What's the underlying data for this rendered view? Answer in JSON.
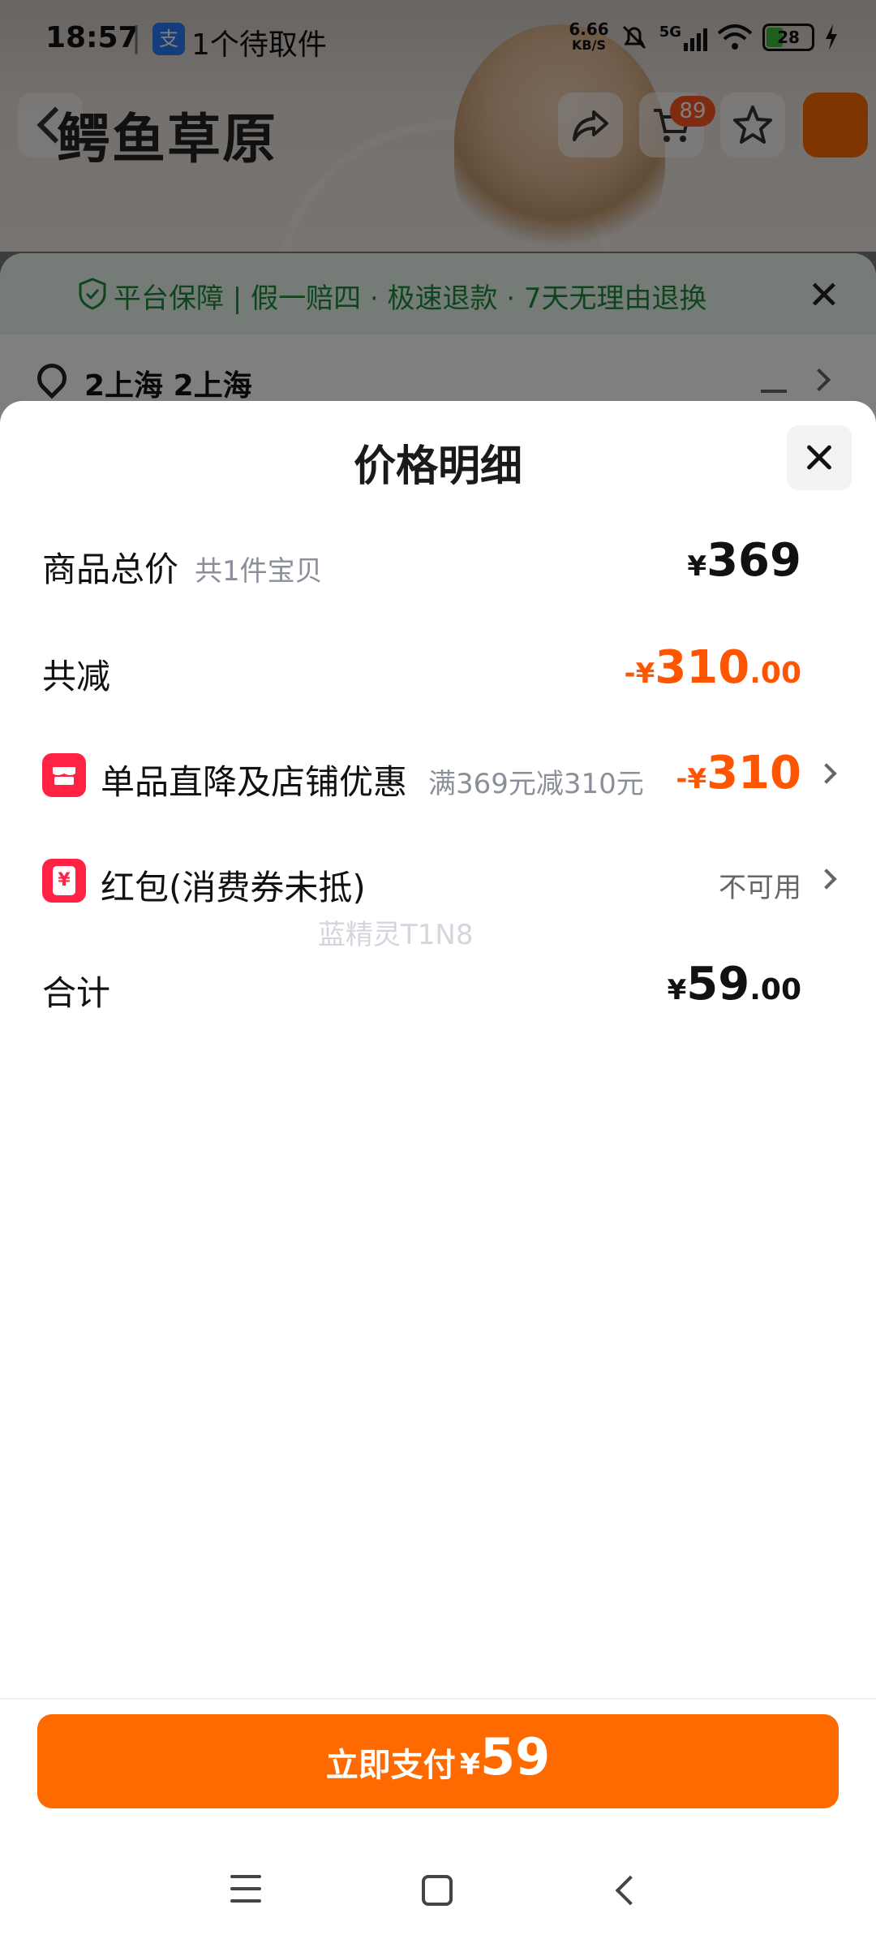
{
  "status_bar": {
    "time": "18:57",
    "notification": "1个待取件",
    "app_icon_char": "支",
    "net_speed_top": "6.66",
    "net_speed_bottom": "KB/S",
    "network": "5G",
    "battery": "28"
  },
  "background_page": {
    "title": "鳄鱼草原",
    "cart_badge": "89",
    "guarantee_text": "平台保障 | 假一赔四 · 极速退款 · 7天无理由退换",
    "address": "2上海 2上海"
  },
  "sheet": {
    "title": "价格明细",
    "rows": {
      "total": {
        "label": "商品总价",
        "sub": "共1件宝贝",
        "yen": "¥",
        "amount": "369"
      },
      "discount": {
        "label": "共减",
        "prefix": "-¥",
        "amount": "310",
        "decimals": ".00"
      },
      "store_promo": {
        "label": "单品直降及店铺优惠",
        "sub": "满369元减310元",
        "prefix": "-¥",
        "amount": "310"
      },
      "red_packet": {
        "label": "红包(消费券未抵)",
        "status": "不可用",
        "icon_char": "¥"
      },
      "sum": {
        "label": "合计",
        "yen": "¥",
        "amount": "59",
        "decimals": ".00"
      }
    },
    "watermark": "蓝精灵T1N8"
  },
  "pay_button": {
    "label": "立即支付",
    "yen": "¥",
    "amount": "59"
  },
  "colors": {
    "accent": "#ff6a00",
    "discount": "#ff5500",
    "icon_red": "#ff2244"
  },
  "nav_icons": [
    "menu-icon",
    "home-icon",
    "back-icon"
  ]
}
